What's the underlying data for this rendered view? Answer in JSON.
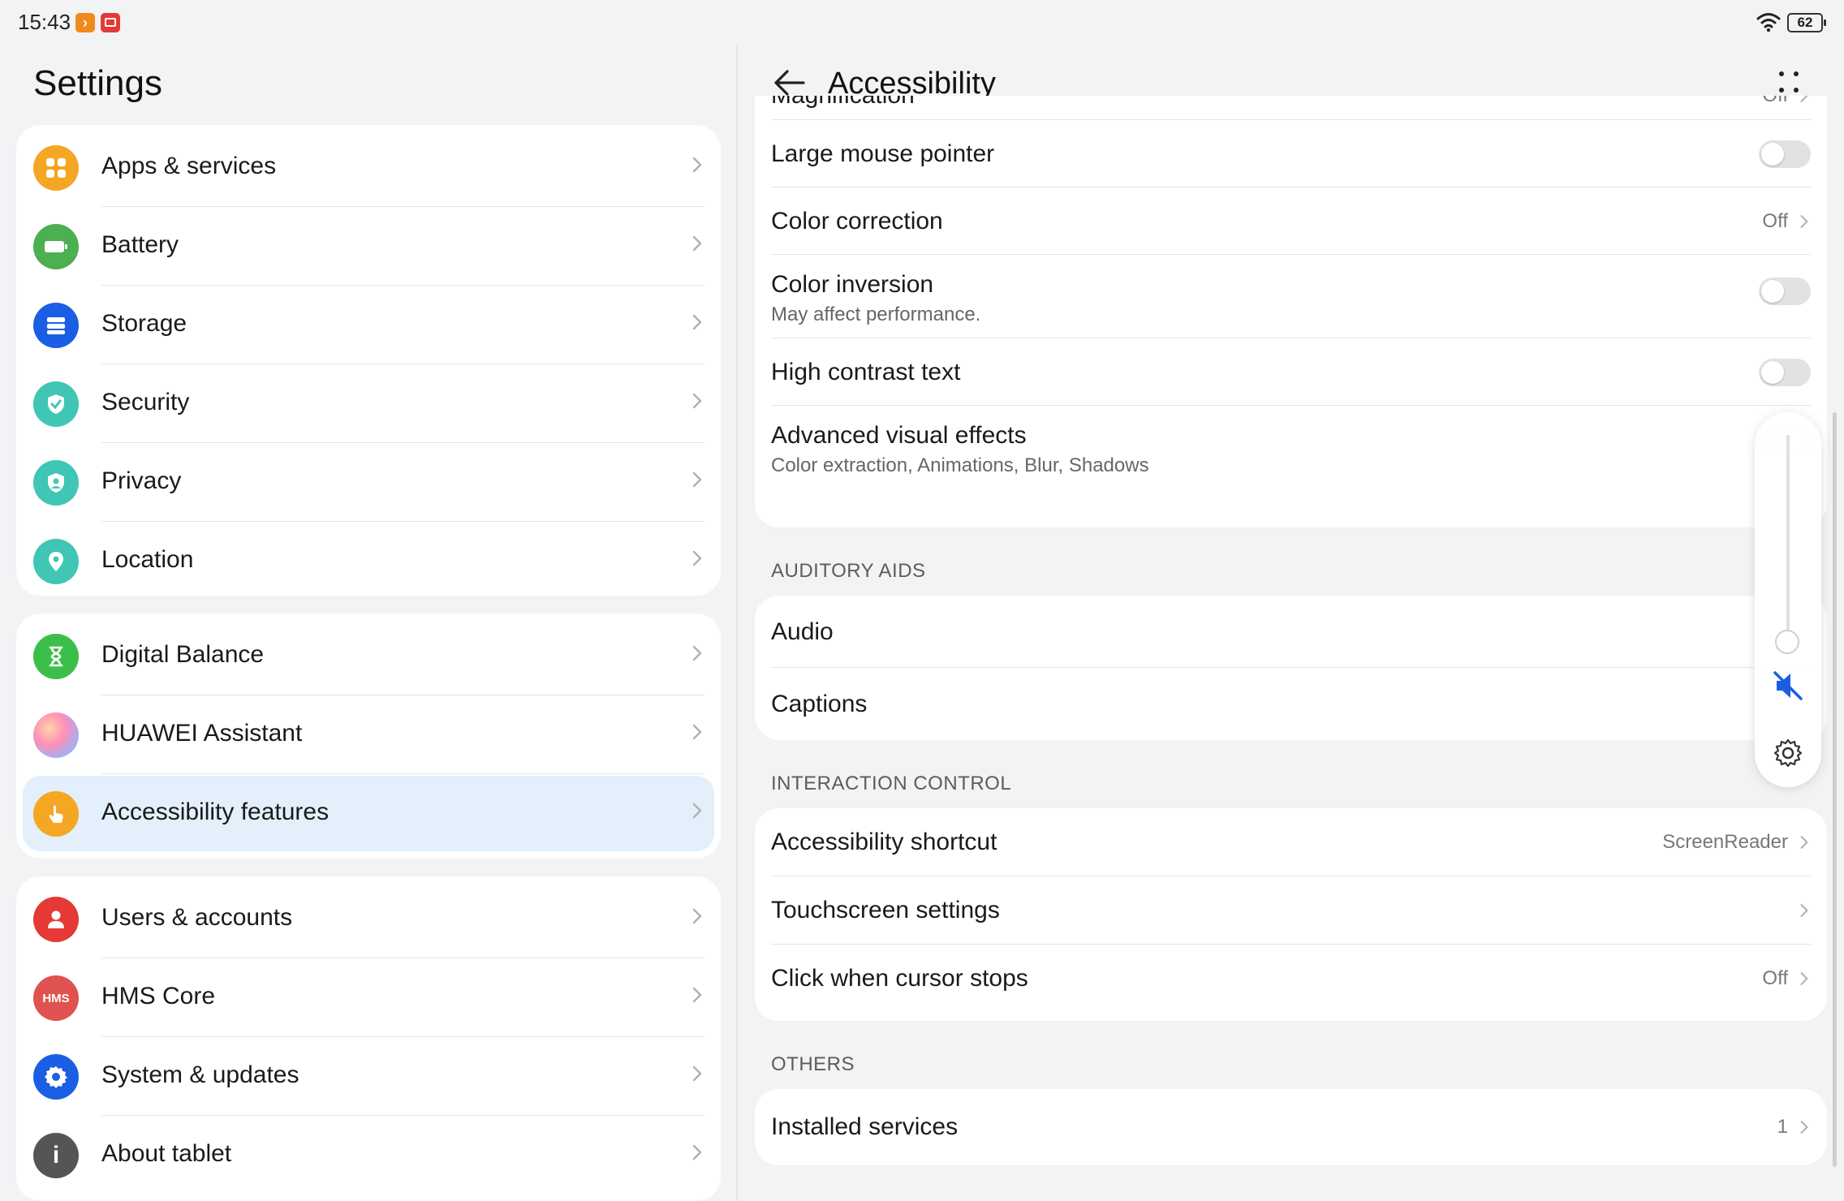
{
  "status_bar": {
    "time": "15:43",
    "battery": "62",
    "icons": [
      "app-notification-icon",
      "app-notification-icon",
      "wifi-icon",
      "battery-icon"
    ]
  },
  "left": {
    "title": "Settings",
    "groups": [
      {
        "items": [
          {
            "label": "Apps & services",
            "icon": "apps-icon",
            "color": "#f5a623"
          },
          {
            "label": "Battery",
            "icon": "battery-icon",
            "color": "#4caf50"
          },
          {
            "label": "Storage",
            "icon": "storage-icon",
            "color": "#1a5fe3"
          },
          {
            "label": "Security",
            "icon": "shield-check-icon",
            "color": "#3fc6b4"
          },
          {
            "label": "Privacy",
            "icon": "privacy-shield-icon",
            "color": "#3fc6b4"
          },
          {
            "label": "Location",
            "icon": "location-pin-icon",
            "color": "#3fc6b4"
          }
        ]
      },
      {
        "items": [
          {
            "label": "Digital Balance",
            "icon": "hourglass-icon",
            "color": "#3cbf4a"
          },
          {
            "label": "HUAWEI Assistant",
            "icon": "assistant-orb-icon",
            "color": "#c77dff"
          },
          {
            "label": "Accessibility features",
            "icon": "hand-pointer-icon",
            "color": "#f5a623",
            "selected": true
          }
        ]
      },
      {
        "items": [
          {
            "label": "Users & accounts",
            "icon": "user-icon",
            "color": "#e53935"
          },
          {
            "label": "HMS Core",
            "icon": "hms-icon",
            "color": "#e0524f",
            "icon_text": "HMS"
          },
          {
            "label": "System & updates",
            "icon": "gear-icon",
            "color": "#1a5fe3"
          },
          {
            "label": "About tablet",
            "icon": "info-icon",
            "color": "#555555",
            "icon_text": "i"
          }
        ]
      }
    ]
  },
  "right": {
    "title": "Accessibility",
    "visual_group": [
      {
        "label": "Magnification",
        "value": "Off",
        "type": "link",
        "partial": true
      },
      {
        "label": "Large mouse pointer",
        "type": "toggle",
        "on": false
      },
      {
        "label": "Color correction",
        "value": "Off",
        "type": "link"
      },
      {
        "label": "Color inversion",
        "sub": "May affect performance.",
        "type": "toggle",
        "on": false
      },
      {
        "label": "High contrast text",
        "type": "toggle",
        "on": false
      },
      {
        "label": "Advanced visual effects",
        "sub": "Color extraction, Animations, Blur, Shadows",
        "type": "toggle",
        "on": true
      }
    ],
    "sections": {
      "auditory": "AUDITORY AIDS",
      "interaction": "INTERACTION CONTROL",
      "others": "OTHERS"
    },
    "auditory_group": [
      {
        "label": "Audio"
      },
      {
        "label": "Captions"
      }
    ],
    "interaction_group": [
      {
        "label": "Accessibility shortcut",
        "value": "ScreenReader"
      },
      {
        "label": "Touchscreen settings",
        "value": ""
      },
      {
        "label": "Click when cursor stops",
        "value": "Off"
      }
    ],
    "others_group": [
      {
        "label": "Installed services",
        "value": "1"
      }
    ]
  },
  "volume_overlay": {
    "level": 0,
    "muted": true,
    "icons": [
      "speaker-muted-icon",
      "gear-icon"
    ]
  },
  "colors": {
    "accent": "#1a5fe3",
    "selected_bg": "#e3f0fb",
    "background": "#f1f3f5"
  }
}
